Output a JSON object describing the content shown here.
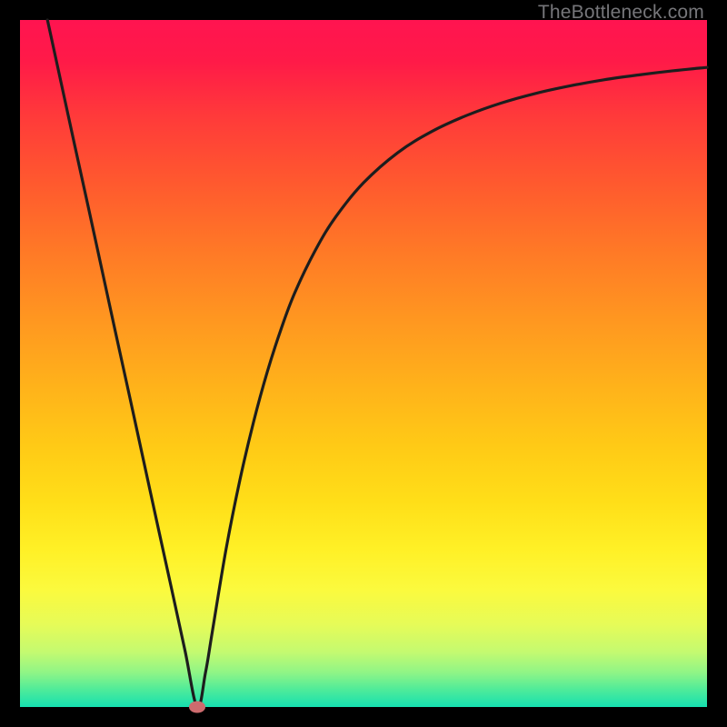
{
  "watermark": "TheBottleneck.com",
  "colors": {
    "frame": "#000000",
    "curve_stroke": "#1d1d1d",
    "marker_fill": "#cd6b6e",
    "gradient_top": "#ff1450",
    "gradient_bottom": "#15e0b0"
  },
  "chart_data": {
    "type": "line",
    "title": "",
    "xlabel": "",
    "ylabel": "",
    "xlim": [
      0,
      100
    ],
    "ylim": [
      0,
      100
    ],
    "series": [
      {
        "name": "bottleneck-curve",
        "x": [
          4.0,
          6.0,
          8.0,
          10.0,
          12.0,
          14.0,
          16.0,
          18.0,
          20.0,
          22.0,
          24.0,
          25.8,
          27.0,
          28.0,
          30.0,
          32.0,
          34.0,
          36.0,
          38.0,
          40.0,
          43.0,
          46.0,
          50.0,
          55.0,
          60.0,
          65.0,
          70.0,
          75.0,
          80.0,
          85.0,
          90.0,
          95.0,
          100.0
        ],
        "values": [
          100.0,
          90.8,
          81.6,
          72.5,
          63.3,
          54.1,
          45.0,
          35.8,
          26.6,
          17.5,
          8.3,
          0.0,
          5.0,
          11.0,
          23.0,
          33.0,
          41.5,
          48.8,
          55.0,
          60.3,
          66.5,
          71.4,
          76.3,
          80.7,
          83.8,
          86.1,
          87.9,
          89.3,
          90.4,
          91.3,
          92.0,
          92.6,
          93.1
        ]
      }
    ],
    "marker": {
      "x": 25.8,
      "y": 0.0
    },
    "gradient_stops": [
      {
        "offset": 0,
        "color": "#ff1450"
      },
      {
        "offset": 0.14,
        "color": "#ff3a3a"
      },
      {
        "offset": 0.34,
        "color": "#ff7a26"
      },
      {
        "offset": 0.54,
        "color": "#ffb41a"
      },
      {
        "offset": 0.7,
        "color": "#ffde18"
      },
      {
        "offset": 0.83,
        "color": "#fbfa3e"
      },
      {
        "offset": 0.92,
        "color": "#c4fa70"
      },
      {
        "offset": 1.0,
        "color": "#15e0b0"
      }
    ]
  }
}
